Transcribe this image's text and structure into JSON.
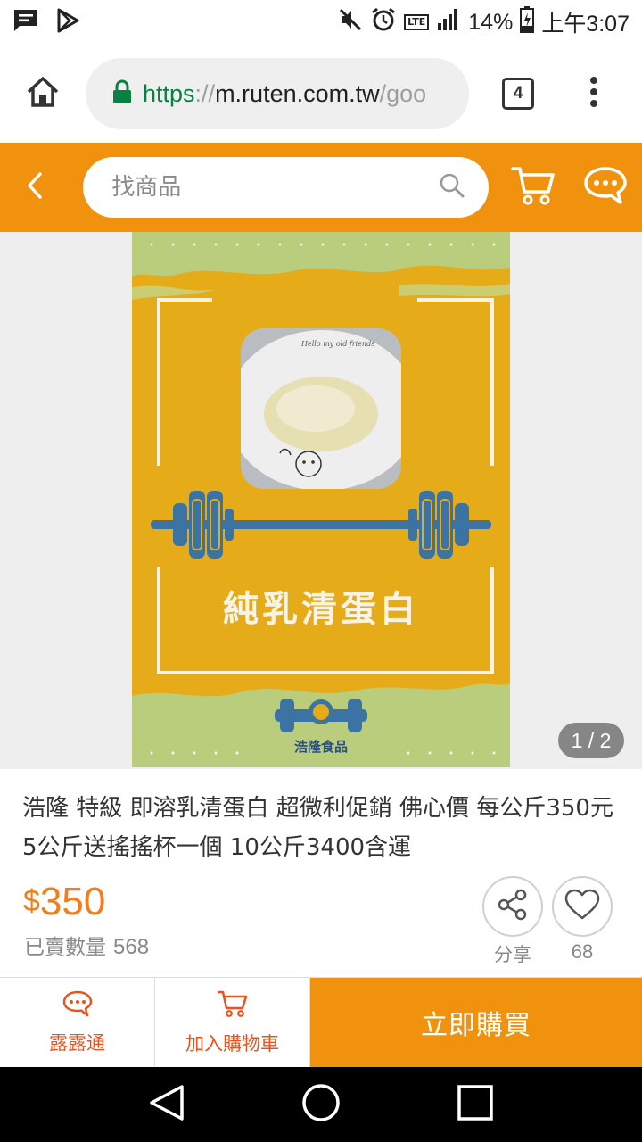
{
  "status_bar": {
    "battery_percent": "14%",
    "time": "上午3:07",
    "network": "LTE"
  },
  "browser": {
    "url_scheme": "https",
    "url_separator": "://",
    "url_host": "m.ruten.com.tw",
    "url_path": "/goo",
    "tab_count": "4"
  },
  "header": {
    "search_placeholder": "找商品"
  },
  "gallery": {
    "image_caption": "純乳清蛋白",
    "brand_logo_text": "浩隆食品",
    "counter": "1 / 2"
  },
  "product": {
    "title": "浩隆 特級 即溶乳清蛋白 超微利促銷 佛心價 每公斤350元 5公斤送搖搖杯一個 10公斤3400含運",
    "currency": "$",
    "price": "350",
    "sold_label": "已賣數量",
    "sold_count": "568",
    "share_label": "分享",
    "like_count": "68"
  },
  "actions": {
    "chat_label": "露露通",
    "add_cart_label": "加入購物車",
    "buy_now_label": "立即購買"
  },
  "colors": {
    "brand_orange": "#f0920e",
    "price_orange": "#f27d1a",
    "action_red": "#e8541c",
    "secure_green": "#0b8043"
  },
  "icons": [
    "message-icon",
    "play-store-icon",
    "mute-icon",
    "alarm-icon",
    "signal-icon",
    "battery-icon",
    "home-icon",
    "lock-icon",
    "menu-dots-icon",
    "back-icon",
    "search-icon",
    "cart-icon",
    "chat-bubble-icon",
    "share-icon",
    "heart-icon",
    "nav-back-icon",
    "nav-home-icon",
    "nav-recents-icon"
  ]
}
